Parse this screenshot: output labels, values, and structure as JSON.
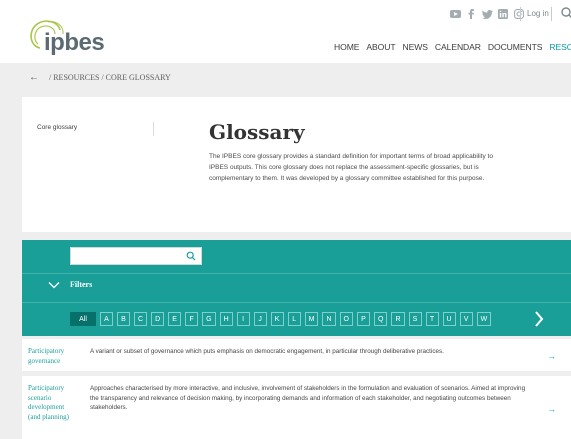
{
  "header": {
    "logo_text": "ipbes",
    "login_label": "Log in",
    "social_icons": [
      "youtube-icon",
      "facebook-icon",
      "twitter-icon",
      "linkedin-icon",
      "instagram-icon"
    ],
    "nav": [
      "HOME",
      "ABOUT",
      "NEWS",
      "CALENDAR",
      "DOCUMENTS",
      "RESOURCES"
    ]
  },
  "breadcrumb": {
    "arrow": "←",
    "path": "/  RESOURCES  /  CORE GLOSSARY"
  },
  "intro": {
    "side_label": "Core glossary",
    "title": "Glossary",
    "description": "The IPBES core glossary provides a standard definition for important terms of broad applicability to IPBES outputs. This core glossary does not replace the assessment-specific glossaries, but is complementary to them. It was developed by a glossary committee established for this purpose."
  },
  "search": {
    "placeholder": ""
  },
  "filters": {
    "label": "Filters",
    "all_label": "All",
    "letters": [
      "A",
      "B",
      "C",
      "D",
      "E",
      "F",
      "G",
      "H",
      "I",
      "J",
      "K",
      "L",
      "M",
      "N",
      "O",
      "P",
      "Q",
      "R",
      "S",
      "T",
      "U",
      "V",
      "W"
    ]
  },
  "entries": [
    {
      "term": "Participatory governance",
      "definition": "A variant or subset of governance which puts emphasis on democratic engagement, in particular through deliberative practices."
    },
    {
      "term": "Participatory scenario development (and planning)",
      "definition": "Approaches characterised by more interactive, and inclusive, involvement of stakeholders in the formulation and evaluation of scenarios. Aimed at improving the transparency and relevance of decision making, by incorporating demands and information of each stakeholder, and negotiating outcomes between stakeholders."
    }
  ],
  "colors": {
    "teal": "#1a9f98",
    "teal_dark": "#07706a",
    "background": "#eeeeee"
  }
}
